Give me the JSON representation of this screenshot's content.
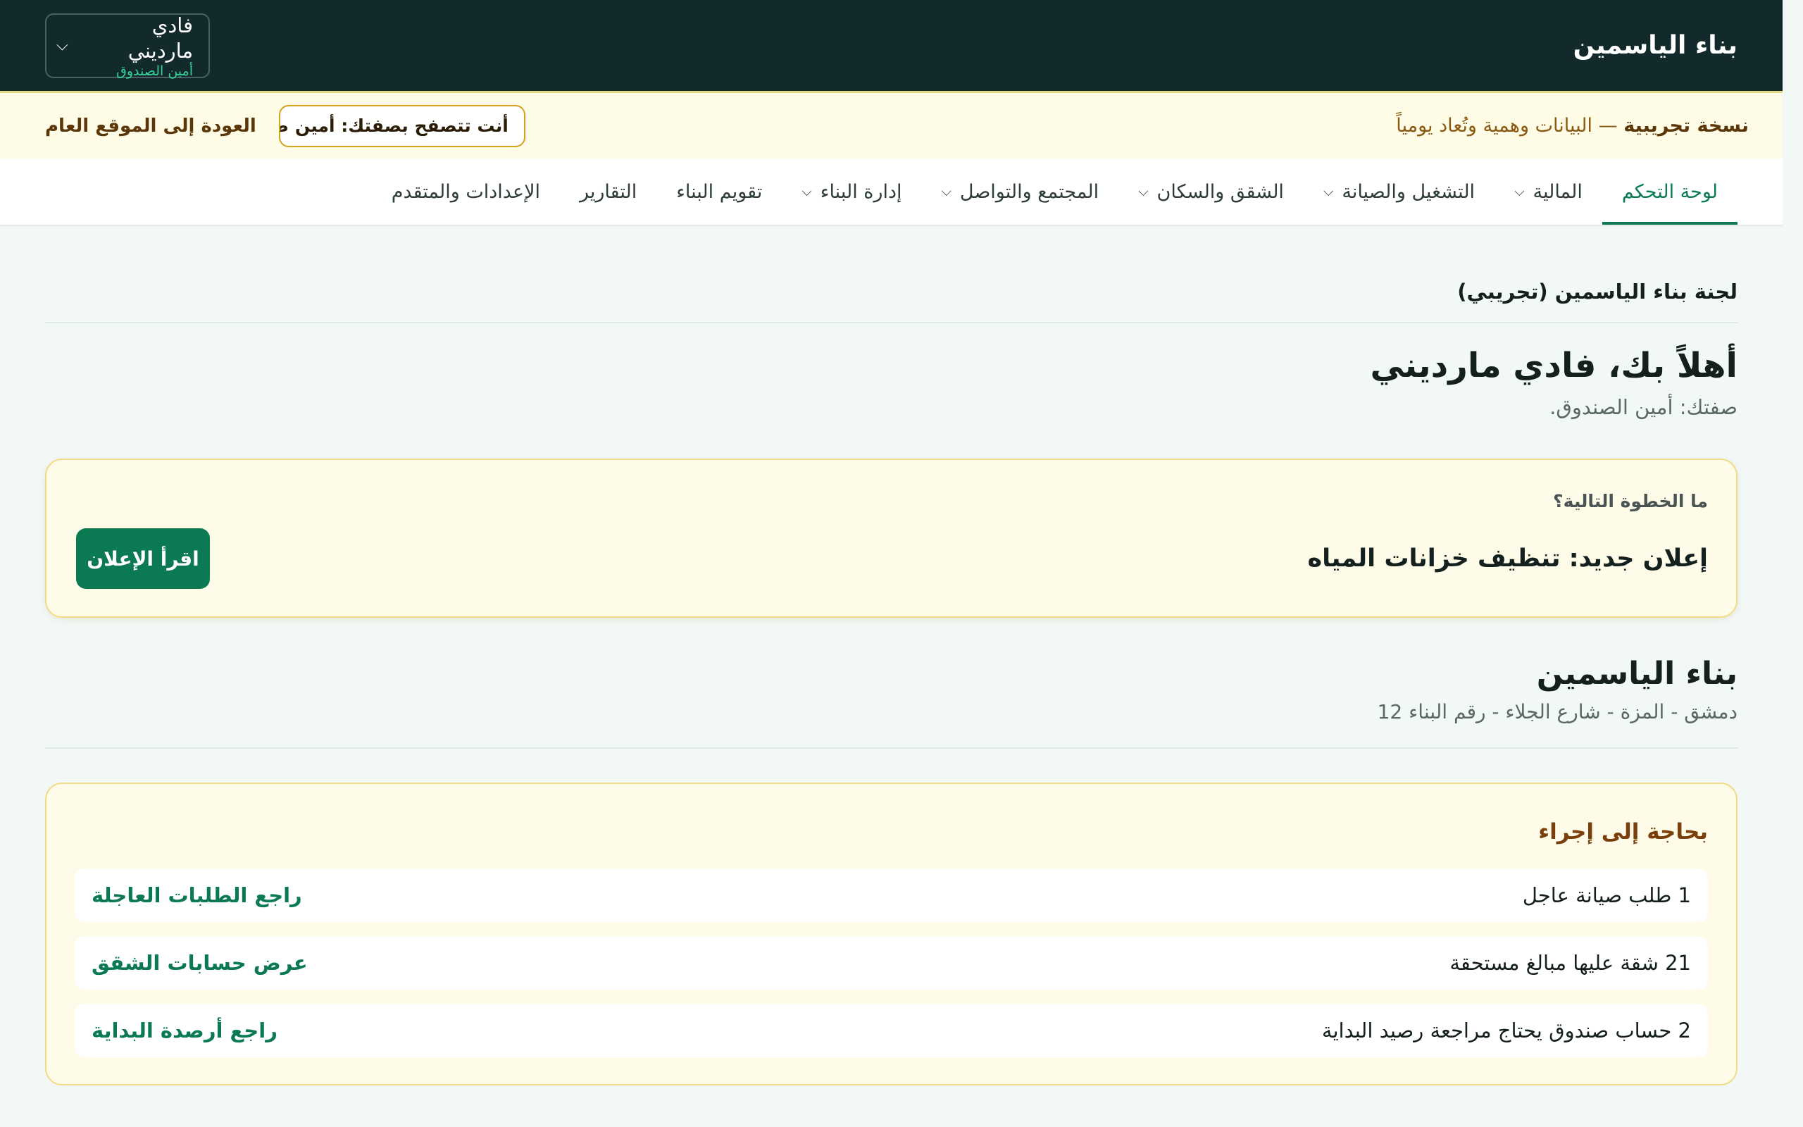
{
  "topbar": {
    "brand": "بناء الياسمين",
    "user_name": "فادي مارديني",
    "user_role": "أمين الصندوق",
    "menu_chevron": "chevron-down-icon"
  },
  "demo_banner": {
    "label": "نسخة تجريبية",
    "message": " — البيانات وهمية وتُعاد يومياً",
    "role_chip": "أنت تتصفح بصفتك: أمين ص...",
    "back_link": "العودة إلى الموقع العام"
  },
  "nav": {
    "items": [
      {
        "label": "لوحة التحكم",
        "active": true,
        "dropdown": false
      },
      {
        "label": "المالية",
        "active": false,
        "dropdown": true
      },
      {
        "label": "التشغيل والصيانة",
        "active": false,
        "dropdown": true
      },
      {
        "label": "الشقق والسكان",
        "active": false,
        "dropdown": true
      },
      {
        "label": "المجتمع والتواصل",
        "active": false,
        "dropdown": true
      },
      {
        "label": "إدارة البناء",
        "active": false,
        "dropdown": true
      },
      {
        "label": "تقويم البناء",
        "active": false,
        "dropdown": false
      },
      {
        "label": "التقارير",
        "active": false,
        "dropdown": false
      },
      {
        "label": "الإعدادات والمتقدم",
        "active": false,
        "dropdown": false
      }
    ]
  },
  "main": {
    "committee": "لجنة بناء الياسمين (تجريبي)",
    "welcome": "أهلاً بك، فادي مارديني",
    "role_line": "صفتك: أمين الصندوق.",
    "next_step": {
      "label": "ما الخطوة التالية؟",
      "title": "إعلان جديد: تنظيف خزانات المياه",
      "button": "اقرأ الإعلان"
    },
    "building": {
      "name": "بناء الياسمين",
      "address": "دمشق - المزة - شارع الجلاء - رقم البناء 12"
    },
    "action_needed": {
      "title": "بحاجة إلى إجراء",
      "rows": [
        {
          "text": "1 طلب صيانة عاجل",
          "link": "راجع الطلبات العاجلة"
        },
        {
          "text": "21 شقة عليها مبالغ مستحقة",
          "link": "عرض حسابات الشقق"
        },
        {
          "text": "2 حساب صندوق يحتاج مراجعة رصيد البداية",
          "link": "راجع أرصدة البداية"
        }
      ]
    }
  },
  "colors": {
    "topbar_bg": "#132a2d",
    "accent": "#0b7a53",
    "banner_bg": "#fefbe6",
    "page_bg": "#f1f8f6"
  }
}
